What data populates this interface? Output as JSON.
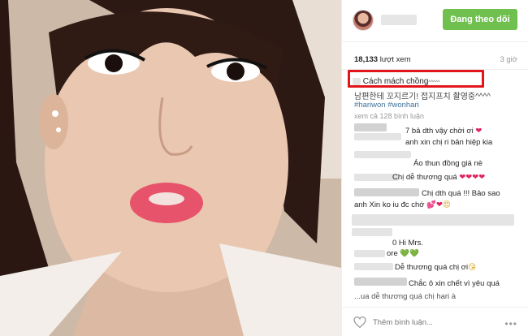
{
  "header": {
    "follow_label": "Đang theo dõi"
  },
  "meta": {
    "views_count": "18,133",
    "views_label": "lượt xem",
    "time": "3 giờ"
  },
  "caption": {
    "text": "Cách mách chồng",
    "suffix": "^^^^^",
    "korean": "남편한테 꼬지르기! 접지프치 촬영중^^^^",
    "hashtags": "#hariwon #wonhari",
    "comment_count": "xem cả 128 bình luận"
  },
  "comments": [
    {
      "text": "7 bả dth vậy chời ơi ",
      "heart": "❤"
    },
    {
      "text": "anh xin chị ri bản hiệp kia"
    },
    {
      "text": "Áo thun đồng giá nè"
    },
    {
      "text": "Chị dễ thương quá ",
      "heart": "❤❤❤❤"
    },
    {
      "text": "Chị dth quá !!! Bảo sao"
    },
    {
      "text": "anh Xin ko iu đc chớ ",
      "heart": "💕❤",
      "emoji": "😍"
    },
    {
      "text": "0 Hi Mrs."
    },
    {
      "text": "ore ",
      "green": "💚💚"
    },
    {
      "text": "Dễ thương quá chị ơi",
      "emoji": "😘"
    },
    {
      "text": "Chắc ô xin chết vì yêu quá"
    },
    {
      "text": "...ua dễ thương quá chị hari à"
    }
  ],
  "footer": {
    "comment_placeholder": "Thêm bình luận...",
    "more_label": "•••"
  },
  "colors": {
    "follow_green": "#70c050",
    "highlight_red": "#e3141b",
    "hashtag_blue": "#3f729b"
  },
  "icons": {
    "like": "heart-outline-icon",
    "more": "ellipsis-icon"
  }
}
